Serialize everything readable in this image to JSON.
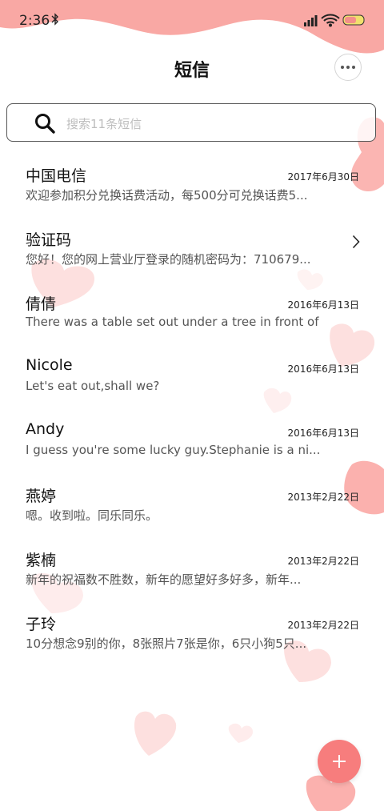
{
  "status_bar": {
    "time": "2:36"
  },
  "header": {
    "title": "短信"
  },
  "search": {
    "placeholder": "搜索11条短信",
    "value": ""
  },
  "messages": [
    {
      "sender": "中国电信",
      "date": "2017年6月30日",
      "preview": "欢迎参加积分兑换话费活动，每500分可兑换话费5..."
    },
    {
      "sender": "验证码",
      "date": "",
      "preview": "您好！您的网上营业厅登录的随机密码为：710679..."
    },
    {
      "sender": "倩倩",
      "date": "2016年6月13日",
      "preview": "There was a table set out under a tree in front of ..."
    },
    {
      "sender": "Nicole",
      "date": "2016年6月13日",
      "preview": "Let's eat out,shall we?"
    },
    {
      "sender": "Andy",
      "date": "2016年6月13日",
      "preview": "I guess you're some lucky guy.Stephanie is a ni..."
    },
    {
      "sender": "燕婷",
      "date": "2013年2月22日",
      "preview": "嗯。收到啦。同乐同乐。"
    },
    {
      "sender": "紫楠",
      "date": "2013年2月22日",
      "preview": "新年的祝福数不胜数，新年的愿望好多好多，新年..."
    },
    {
      "sender": "子玲",
      "date": "2013年2月22日",
      "preview": "10分想念9别的你，8张照片7张是你，6只小狗5只..."
    }
  ],
  "icons": {
    "bluetooth": "bluetooth-icon",
    "signal": "signal-icon",
    "wifi": "wifi-icon",
    "battery": "battery-icon",
    "more": "more-icon",
    "search": "search-icon",
    "chevron": "chevron-right-icon",
    "add": "plus-icon"
  },
  "colors": {
    "accent": "#f77d7d",
    "wave": "#f9a3a0",
    "heart_light": "#fde0df"
  }
}
